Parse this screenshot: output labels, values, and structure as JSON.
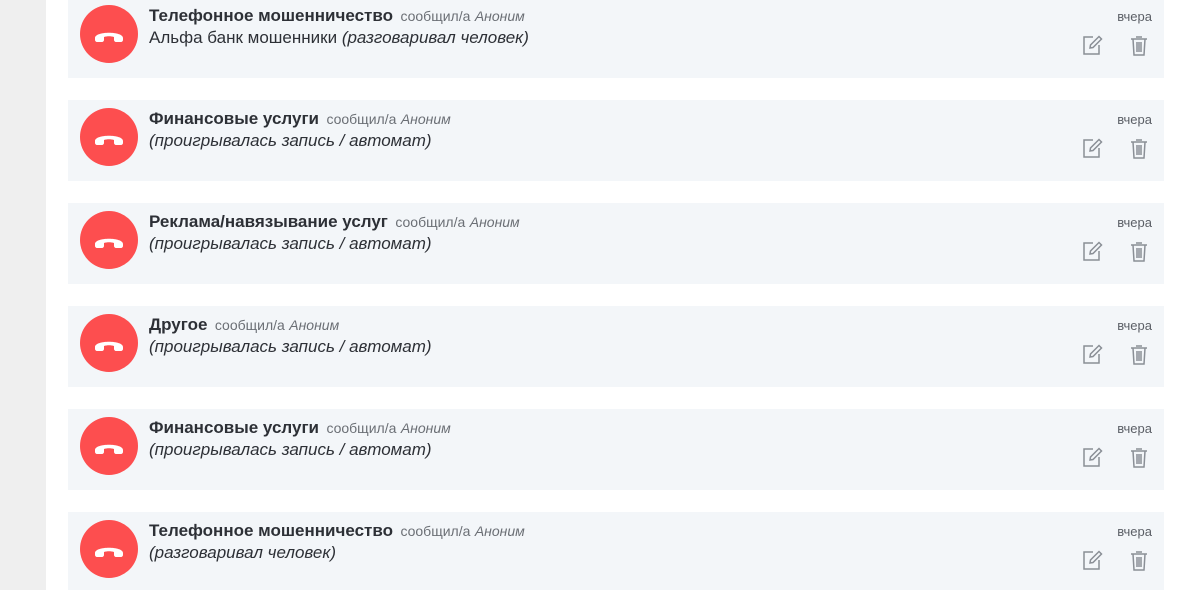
{
  "accent_color": "#fd4e4f",
  "icons": {
    "avatar": "hangup-phone-icon",
    "edit": "edit-icon",
    "delete": "trash-icon"
  },
  "reports": [
    {
      "category": "Телефонное мошенничество",
      "reported_by": "сообщил/а",
      "author": "Аноним",
      "comment": "Альфа банк мошенники",
      "call_type": "(разговаривал человек)",
      "time": "вчера"
    },
    {
      "category": "Финансовые услуги",
      "reported_by": "сообщил/а",
      "author": "Аноним",
      "comment": "",
      "call_type": "(проигрывалась запись / автомат)",
      "time": "вчера"
    },
    {
      "category": "Реклама/навязывание услуг",
      "reported_by": "сообщил/а",
      "author": "Аноним",
      "comment": "",
      "call_type": "(проигрывалась запись / автомат)",
      "time": "вчера"
    },
    {
      "category": "Другое",
      "reported_by": "сообщил/а",
      "author": "Аноним",
      "comment": "",
      "call_type": "(проигрывалась запись / автомат)",
      "time": "вчера"
    },
    {
      "category": "Финансовые услуги",
      "reported_by": "сообщил/а",
      "author": "Аноним",
      "comment": "",
      "call_type": "(проигрывалась запись / автомат)",
      "time": "вчера"
    },
    {
      "category": "Телефонное мошенничество",
      "reported_by": "сообщил/а",
      "author": "Аноним",
      "comment": "",
      "call_type": "(разговаривал человек)",
      "time": "вчера"
    }
  ]
}
